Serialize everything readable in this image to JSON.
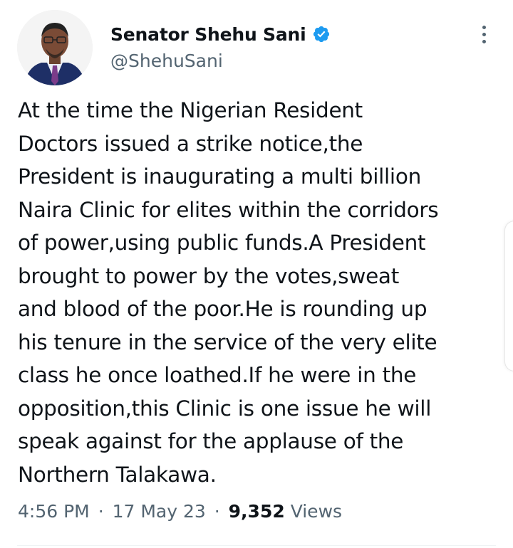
{
  "author": {
    "display_name": "Senator Shehu Sani",
    "handle": "@ShehuSani",
    "verified": true,
    "verified_color": "#1d9bf0"
  },
  "icons": {
    "avatar": "profile-photo",
    "verified": "verified-badge-icon",
    "more": "more-vertical-icon"
  },
  "tweet": {
    "lines": [
      "At the time the Nigerian Resident",
      "Doctors issued a strike notice,the",
      "President is inaugurating a multi billion",
      "Naira Clinic for elites within the corridors",
      "of power,using public funds.A President",
      "brought to power by the votes,sweat",
      "and blood of the poor.He is rounding up",
      "his tenure in the service of the very elite",
      "class he once loathed.If he were in the",
      "opposition,this Clinic is one issue he will",
      "speak against for the applause of the",
      "Northern Talakawa."
    ]
  },
  "meta": {
    "time": "4:56 PM",
    "separator": "·",
    "date": "17 May 23",
    "views_count": "9,352",
    "views_label": "Views"
  },
  "colors": {
    "text_primary": "#0f1419",
    "text_secondary": "#536471",
    "divider": "#eff3f4"
  }
}
